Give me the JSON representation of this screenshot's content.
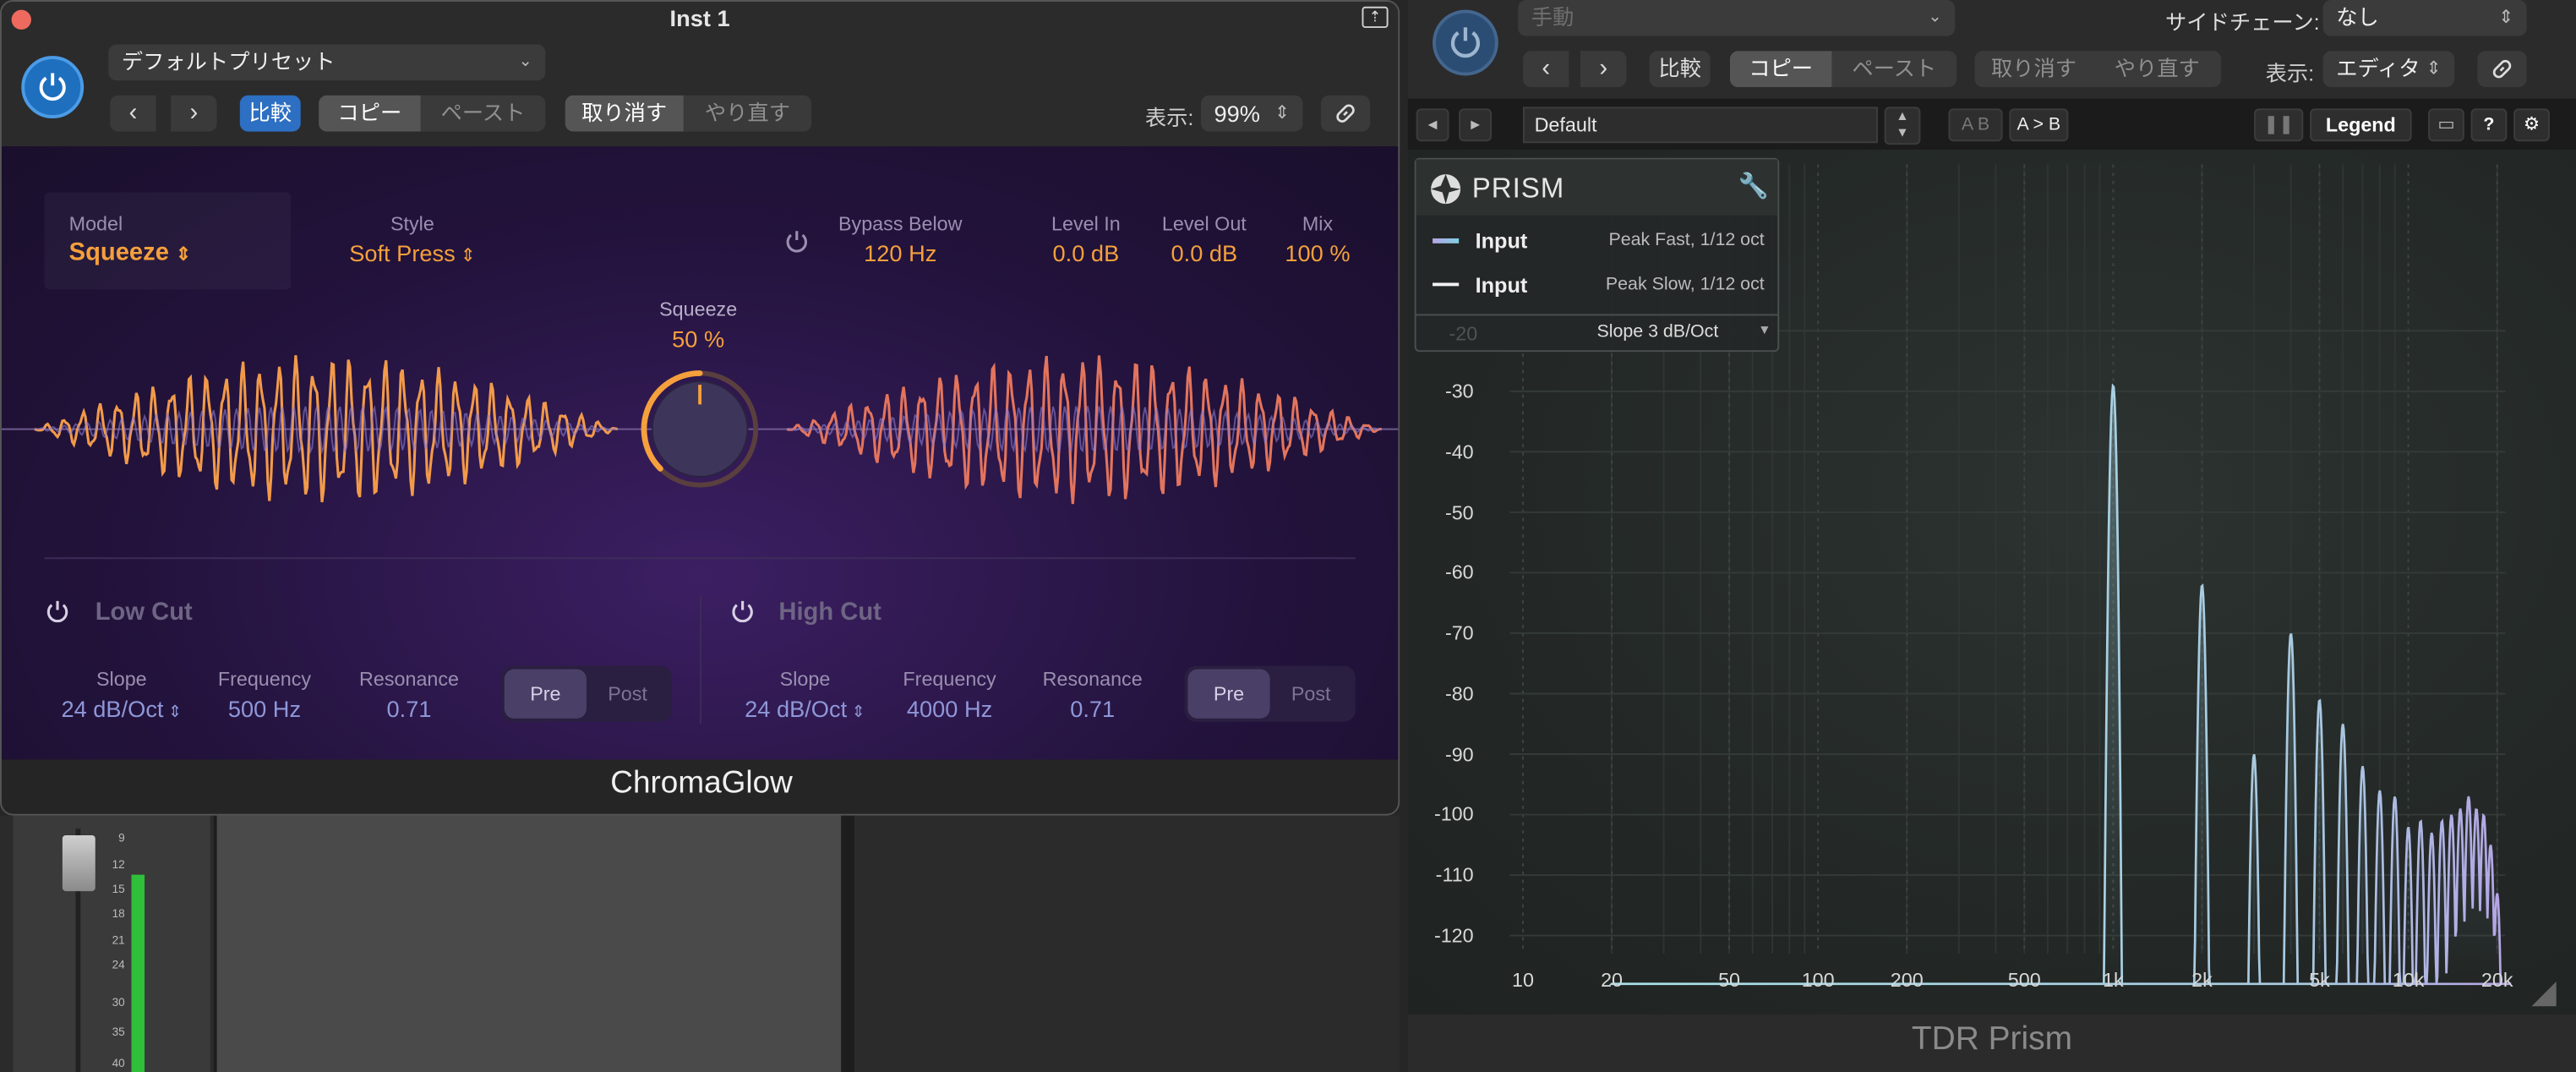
{
  "chromaglow_window": {
    "title": "Inst 1",
    "preset": "デフォルトプリセット",
    "compare_label": "比較",
    "copy_label": "コピー",
    "paste_label": "ペースト",
    "undo_label": "取り消す",
    "redo_label": "やり直す",
    "view_label": "表示:",
    "zoom_value": "99%",
    "plugin_name": "ChromaGlow",
    "model_label": "Model",
    "model_value": "Squeeze",
    "style_label": "Style",
    "style_value": "Soft Press",
    "bypass_below_label": "Bypass Below",
    "bypass_below_value": "120 Hz",
    "level_in_label": "Level In",
    "level_in_value": "0.0 dB",
    "level_out_label": "Level Out",
    "level_out_value": "0.0 dB",
    "mix_label": "Mix",
    "mix_value": "100 %",
    "squeeze_label": "Squeeze",
    "squeeze_value": "50 %",
    "squeeze_level": 0.5,
    "low_cut": {
      "title": "Low Cut",
      "slope_label": "Slope",
      "slope_value": "24 dB/Oct",
      "freq_label": "Frequency",
      "freq_value": "500 Hz",
      "res_label": "Resonance",
      "res_value": "0.71",
      "pre_label": "Pre",
      "post_label": "Post"
    },
    "high_cut": {
      "title": "High Cut",
      "slope_label": "Slope",
      "slope_value": "24 dB/Oct",
      "freq_label": "Frequency",
      "freq_value": "4000 Hz",
      "res_label": "Resonance",
      "res_value": "0.71",
      "pre_label": "Pre",
      "post_label": "Post"
    }
  },
  "prism_window": {
    "preset_mode": "手動",
    "sidechain_label": "サイドチェーン:",
    "sidechain_value": "なし",
    "compare_label": "比較",
    "copy_label": "コピー",
    "paste_label": "ペースト",
    "undo_label": "取り消す",
    "redo_label": "やり直す",
    "view_label": "表示:",
    "view_value": "エディタ",
    "preset_name": "Default",
    "ab_label": "A B",
    "a_to_b_label": "A > B",
    "legend_button": "Legend",
    "help_label": "?",
    "plugin_name": "TDR Prism",
    "legend": {
      "title": "PRISM",
      "rows": [
        {
          "name": "Input",
          "detail": "Peak Fast, 1/12 oct"
        },
        {
          "name": "Input",
          "detail": "Peak Slow, 1/12 oct"
        }
      ],
      "slope": "Slope 3 dB/Oct",
      "hidden_tick": "-20"
    },
    "y_ticks": [
      "-30",
      "-40",
      "-50",
      "-60",
      "-70",
      "-80",
      "-90",
      "-100",
      "-110",
      "-120"
    ],
    "x_ticks": [
      "10",
      "20",
      "50",
      "100",
      "200",
      "500",
      "1k",
      "2k",
      "5k",
      "10k",
      "20k"
    ]
  },
  "mixer": {
    "scale": [
      "9",
      "12",
      "15",
      "18",
      "21",
      "24",
      "30",
      "35",
      "40"
    ]
  },
  "colors": {
    "logic_blue": "#1f6fbf",
    "orange": "#f5a03c",
    "periwinkle": "#8f97d8",
    "prism_trace": "#9fd3e0"
  }
}
